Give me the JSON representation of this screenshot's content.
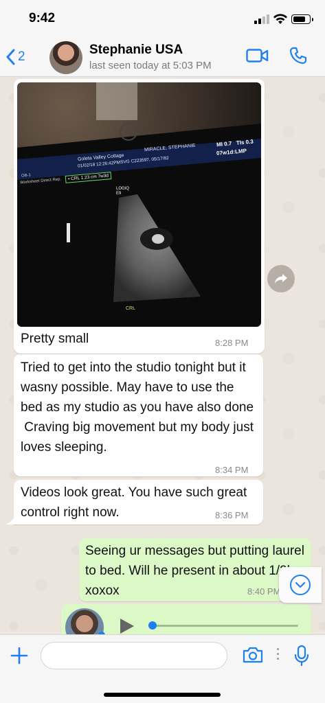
{
  "status_bar": {
    "time": "9:42"
  },
  "header": {
    "back_count": "2",
    "contact_name": "Stephanie USA",
    "last_seen": "last seen today at 5:03 PM"
  },
  "photo": {
    "clinic": "Goleta Valley Cottage",
    "timestamp": "01/02/18 12:26:42PM",
    "study": "SVG  C223597, 05/17/82",
    "patient": "MIRACLE, STEPHANIE",
    "mi": "MI 0.7   TIs 0.3",
    "ga": "07w1d:LMP",
    "crl_measure": "• CRL 1.23 cm  7w3d",
    "ob_label": "OB-1",
    "worksheet": "Worksheet  Direct Rep.",
    "logo_label": "LOGIQ\nE9",
    "crl_label": "CRL"
  },
  "messages": [
    {
      "direction": "in",
      "text": "Pretty small",
      "time": "8:28 PM"
    },
    {
      "direction": "in",
      "text": "Tried to get into the studio tonight but it wasny possible. May have to use the bed as my studio as you have also done\n Craving big movement but my body just loves sleeping.",
      "time": "8:34 PM"
    },
    {
      "direction": "in",
      "text": "Videos look great. You have such great control right now.",
      "time": "8:36 PM"
    },
    {
      "direction": "out",
      "text": "Seeing ur messages but putting laurel to bed. Will he present in about 1/2hr xoxox",
      "time": "8:40 PM"
    }
  ],
  "voice_note": {
    "progress": 0.0
  },
  "input": {
    "placeholder": ""
  },
  "colors": {
    "accent": "#1f7ef1",
    "outgoing_bubble": "#dcf8c6",
    "incoming_bubble": "#ffffff",
    "chat_background": "#ece5dd"
  }
}
